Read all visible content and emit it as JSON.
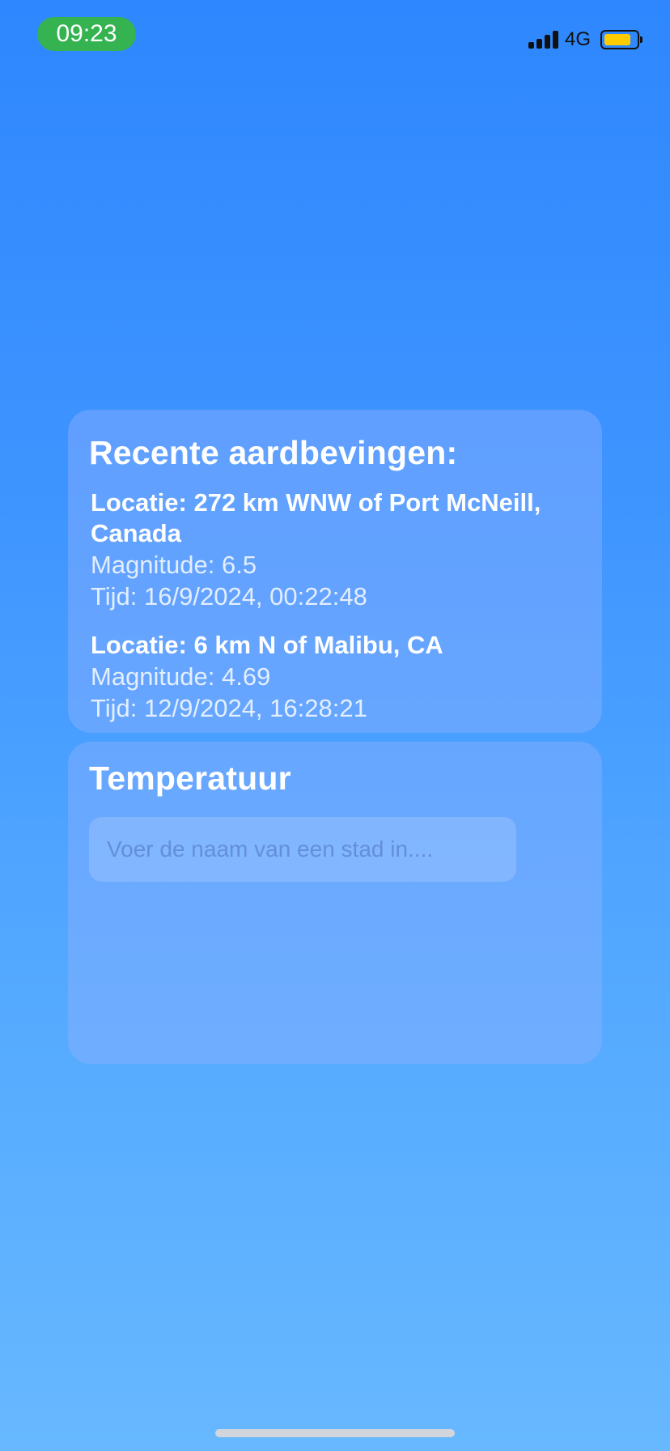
{
  "status_bar": {
    "time": "09:23",
    "network": "4G",
    "signal_icon": "signal-bars-icon",
    "battery_icon": "battery-icon",
    "battery_level": 0.85,
    "battery_color": "#ffcc00",
    "time_pill_color": "#34b350"
  },
  "earthquakes": {
    "title": "Recente aardbevingen:",
    "items": [
      {
        "location": "Locatie: 272 km WNW of Port McNeill, Canada",
        "magnitude": "Magnitude: 6.5",
        "time": "Tijd: 16/9/2024, 00:22:48"
      },
      {
        "location": "Locatie: 6 km N of Malibu, CA",
        "magnitude": "Magnitude: 4.69",
        "time": "Tijd: 12/9/2024, 16:28:21"
      }
    ]
  },
  "temperature": {
    "title": "Temperatuur",
    "input_placeholder": "Voer de naam van een stad in....",
    "input_value": ""
  }
}
